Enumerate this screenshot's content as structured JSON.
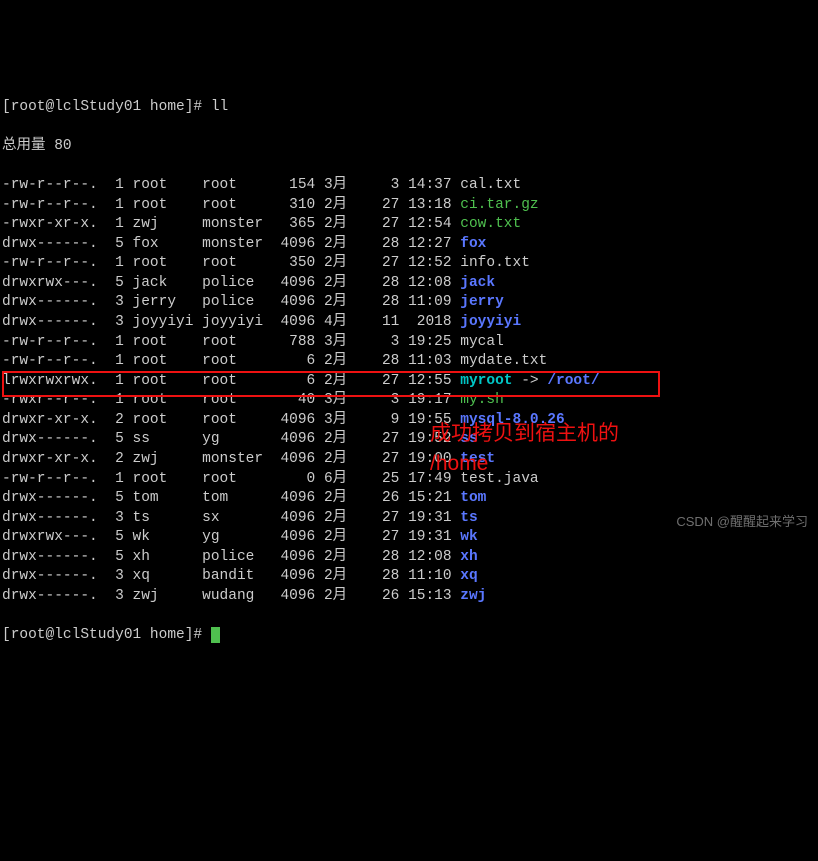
{
  "prompt_top": "[root@lclStudy01 home]# ll",
  "total_line": "总用量 80",
  "rows": [
    {
      "perm": "-rw-r--r--.",
      "n": "1",
      "own": "root",
      "grp": "root",
      "size": "154",
      "mon": "3月",
      "day": "3",
      "time": "14:37",
      "file": "cal.txt",
      "cls": "white"
    },
    {
      "perm": "-rw-r--r--.",
      "n": "1",
      "own": "root",
      "grp": "root",
      "size": "310",
      "mon": "2月",
      "day": "27",
      "time": "13:18",
      "file": "ci.tar.gz",
      "cls": "green"
    },
    {
      "perm": "-rwxr-xr-x.",
      "n": "1",
      "own": "zwj",
      "grp": "monster",
      "size": "365",
      "mon": "2月",
      "day": "27",
      "time": "12:54",
      "file": "cow.txt",
      "cls": "green"
    },
    {
      "perm": "drwx------.",
      "n": "5",
      "own": "fox",
      "grp": "monster",
      "size": "4096",
      "mon": "2月",
      "day": "28",
      "time": "12:27",
      "file": "fox",
      "cls": "blue"
    },
    {
      "perm": "-rw-r--r--.",
      "n": "1",
      "own": "root",
      "grp": "root",
      "size": "350",
      "mon": "2月",
      "day": "27",
      "time": "12:52",
      "file": "info.txt",
      "cls": "white"
    },
    {
      "perm": "drwxrwx---.",
      "n": "5",
      "own": "jack",
      "grp": "police",
      "size": "4096",
      "mon": "2月",
      "day": "28",
      "time": "12:08",
      "file": "jack",
      "cls": "blue"
    },
    {
      "perm": "drwx------.",
      "n": "3",
      "own": "jerry",
      "grp": "police",
      "size": "4096",
      "mon": "2月",
      "day": "28",
      "time": "11:09",
      "file": "jerry",
      "cls": "blue"
    },
    {
      "perm": "drwx------.",
      "n": "3",
      "own": "joyyiyi",
      "grp": "joyyiyi",
      "size": "4096",
      "mon": "4月",
      "day": "11",
      "time": "2018",
      "file": "joyyiyi",
      "cls": "blue"
    },
    {
      "perm": "-rw-r--r--.",
      "n": "1",
      "own": "root",
      "grp": "root",
      "size": "788",
      "mon": "3月",
      "day": "3",
      "time": "19:25",
      "file": "mycal",
      "cls": "white"
    },
    {
      "perm": "-rw-r--r--.",
      "n": "1",
      "own": "root",
      "grp": "root",
      "size": "6",
      "mon": "2月",
      "day": "28",
      "time": "11:03",
      "file": "mydate.txt",
      "cls": "white"
    },
    {
      "perm": "lrwxrwxrwx.",
      "n": "1",
      "own": "root",
      "grp": "root",
      "size": "6",
      "mon": "2月",
      "day": "27",
      "time": "12:55",
      "file": "myroot",
      "cls": "cyan",
      "arrow": " -> ",
      "target": "/root/",
      "tcls": "blue"
    },
    {
      "perm": "-rwxr--r--.",
      "n": "1",
      "own": "root",
      "grp": "root",
      "size": "40",
      "mon": "3月",
      "day": "3",
      "time": "19:17",
      "file": "my.sh",
      "cls": "green"
    },
    {
      "perm": "drwxr-xr-x.",
      "n": "2",
      "own": "root",
      "grp": "root",
      "size": "4096",
      "mon": "3月",
      "day": "9",
      "time": "19:55",
      "file": "mysql-8.0.26",
      "cls": "blue"
    },
    {
      "perm": "drwx------.",
      "n": "5",
      "own": "ss",
      "grp": "yg",
      "size": "4096",
      "mon": "2月",
      "day": "27",
      "time": "19:52",
      "file": "ss",
      "cls": "blue"
    },
    {
      "perm": "drwxr-xr-x.",
      "n": "2",
      "own": "zwj",
      "grp": "monster",
      "size": "4096",
      "mon": "2月",
      "day": "27",
      "time": "19:00",
      "file": "test",
      "cls": "blue"
    },
    {
      "perm": "-rw-r--r--.",
      "n": "1",
      "own": "root",
      "grp": "root",
      "size": "0",
      "mon": "6月",
      "day": "25",
      "time": "17:49",
      "file": "test.java",
      "cls": "white"
    },
    {
      "perm": "drwx------.",
      "n": "5",
      "own": "tom",
      "grp": "tom",
      "size": "4096",
      "mon": "2月",
      "day": "26",
      "time": "15:21",
      "file": "tom",
      "cls": "blue"
    },
    {
      "perm": "drwx------.",
      "n": "3",
      "own": "ts",
      "grp": "sx",
      "size": "4096",
      "mon": "2月",
      "day": "27",
      "time": "19:31",
      "file": "ts",
      "cls": "blue"
    },
    {
      "perm": "drwxrwx---.",
      "n": "5",
      "own": "wk",
      "grp": "yg",
      "size": "4096",
      "mon": "2月",
      "day": "27",
      "time": "19:31",
      "file": "wk",
      "cls": "blue"
    },
    {
      "perm": "drwx------.",
      "n": "5",
      "own": "xh",
      "grp": "police",
      "size": "4096",
      "mon": "2月",
      "day": "28",
      "time": "12:08",
      "file": "xh",
      "cls": "blue"
    },
    {
      "perm": "drwx------.",
      "n": "3",
      "own": "xq",
      "grp": "bandit",
      "size": "4096",
      "mon": "2月",
      "day": "28",
      "time": "11:10",
      "file": "xq",
      "cls": "blue"
    },
    {
      "perm": "drwx------.",
      "n": "3",
      "own": "zwj",
      "grp": "wudang",
      "size": "4096",
      "mon": "2月",
      "day": "26",
      "time": "15:13",
      "file": "zwj",
      "cls": "blue"
    }
  ],
  "prompt_bottom": "[root@lclStudy01 home]# ",
  "annotation_line1": "成功拷贝到宿主机的",
  "annotation_line2": "/home",
  "watermark": "CSDN @醒醒起来学习"
}
